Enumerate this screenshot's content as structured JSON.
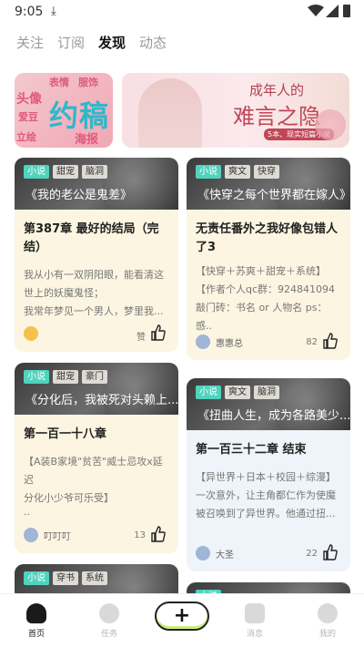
{
  "status_bar": {
    "time": "9:05"
  },
  "top_tabs": [
    {
      "label": "关注",
      "active": false
    },
    {
      "label": "订阅",
      "active": false
    },
    {
      "label": "发现",
      "active": true
    },
    {
      "label": "动态",
      "active": false
    }
  ],
  "banners": [
    {
      "words": [
        "头像",
        "表情",
        "服饰",
        "爱豆",
        "立绘",
        "海报"
      ],
      "big_text": "约稿"
    },
    {
      "line1": "成年人的",
      "line2": "难言之隐",
      "badge": "5本、现实短篇小说"
    }
  ],
  "cards": [
    {
      "tags": [
        "小说",
        "甜宠",
        "脑洞"
      ],
      "title": "《我的老公是鬼差》",
      "chapter": "第387章 最好的结局（完结）",
      "excerpt": [
        "我从小有一双阴阳眼，能看清这",
        "世上的妖魔鬼怪；",
        "我常年梦见一个男人，梦里我..."
      ],
      "author": "",
      "likes": "赞"
    },
    {
      "tags": [
        "小说",
        "爽文",
        "快穿"
      ],
      "title": "《快穿之每个世界都在嫁人》",
      "chapter": "无责任番外之我好像包错人了3",
      "excerpt": [
        "【快穿＋苏爽＋甜宠＋系统】",
        "【作者个人qc群：924841094",
        "敲门砖：书名 or 人物名 ps：感.."
      ],
      "author": "惠惠总",
      "likes": "82"
    },
    {
      "tags": [
        "小说",
        "甜宠",
        "豪门"
      ],
      "title": "《分化后，我被死对头赖上...",
      "chapter": "第一百一十八章",
      "excerpt": [
        "【A装B家境\"贫苦\"威士忌攻x延迟",
        "分化小少爷可乐受】",
        ".."
      ],
      "author": "叮叮叮",
      "likes": "13"
    },
    {
      "tags": [
        "小说",
        "爽文",
        "脑洞"
      ],
      "title": "《扭曲人生，成为各路美少...",
      "chapter": "第一百三十二章 结束",
      "excerpt": [
        "【异世界＋日本＋校园＋综漫】",
        "一次意外，让主角都仁作为使魔",
        "被召唤到了异世界。他通过扭..."
      ],
      "author": "大圣",
      "likes": "22"
    },
    {
      "tags": [
        "小说",
        "穿书",
        "系统"
      ]
    },
    {
      "tags": [
        "小说"
      ]
    }
  ],
  "bottom_nav": [
    {
      "label": "首页",
      "icon": "home-icon",
      "active": true
    },
    {
      "label": "任务",
      "icon": "task-icon",
      "active": false
    },
    {
      "label": "消息",
      "icon": "message-icon",
      "active": false
    },
    {
      "label": "我的",
      "icon": "profile-icon",
      "active": false
    }
  ],
  "create_button": "+"
}
